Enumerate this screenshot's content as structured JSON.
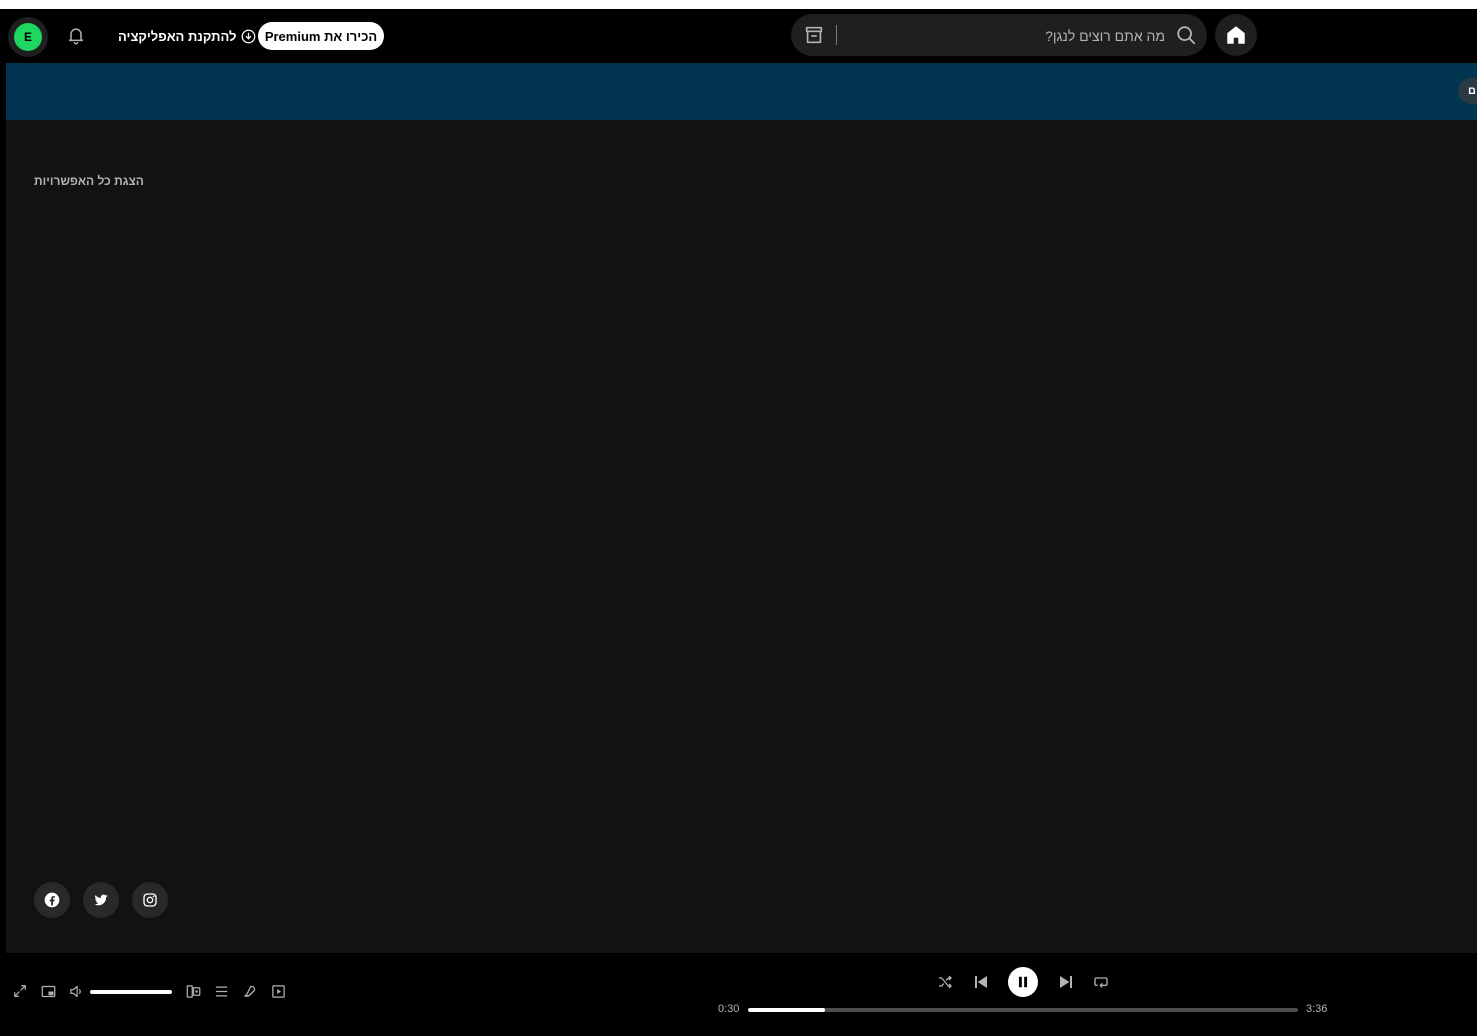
{
  "header": {
    "search_placeholder": "מה אתם רוצים לנגן?",
    "premium_label": "הכירו את Premium",
    "install_label": "להתקנת האפליקציה",
    "avatar_initial": "E"
  },
  "banner": {
    "pill_label": "ם"
  },
  "main": {
    "show_all_label": "הצגת כל האפשרויות"
  },
  "social": [
    "facebook-icon",
    "twitter-icon",
    "instagram-icon"
  ],
  "player": {
    "elapsed": "0:30",
    "duration": "3:36",
    "progress_fraction": 0.14,
    "volume_fraction": 1.0
  },
  "colors": {
    "accent": "#1ed760",
    "banner": "#023650",
    "surface": "#121212",
    "pill": "#1f1f1f"
  }
}
